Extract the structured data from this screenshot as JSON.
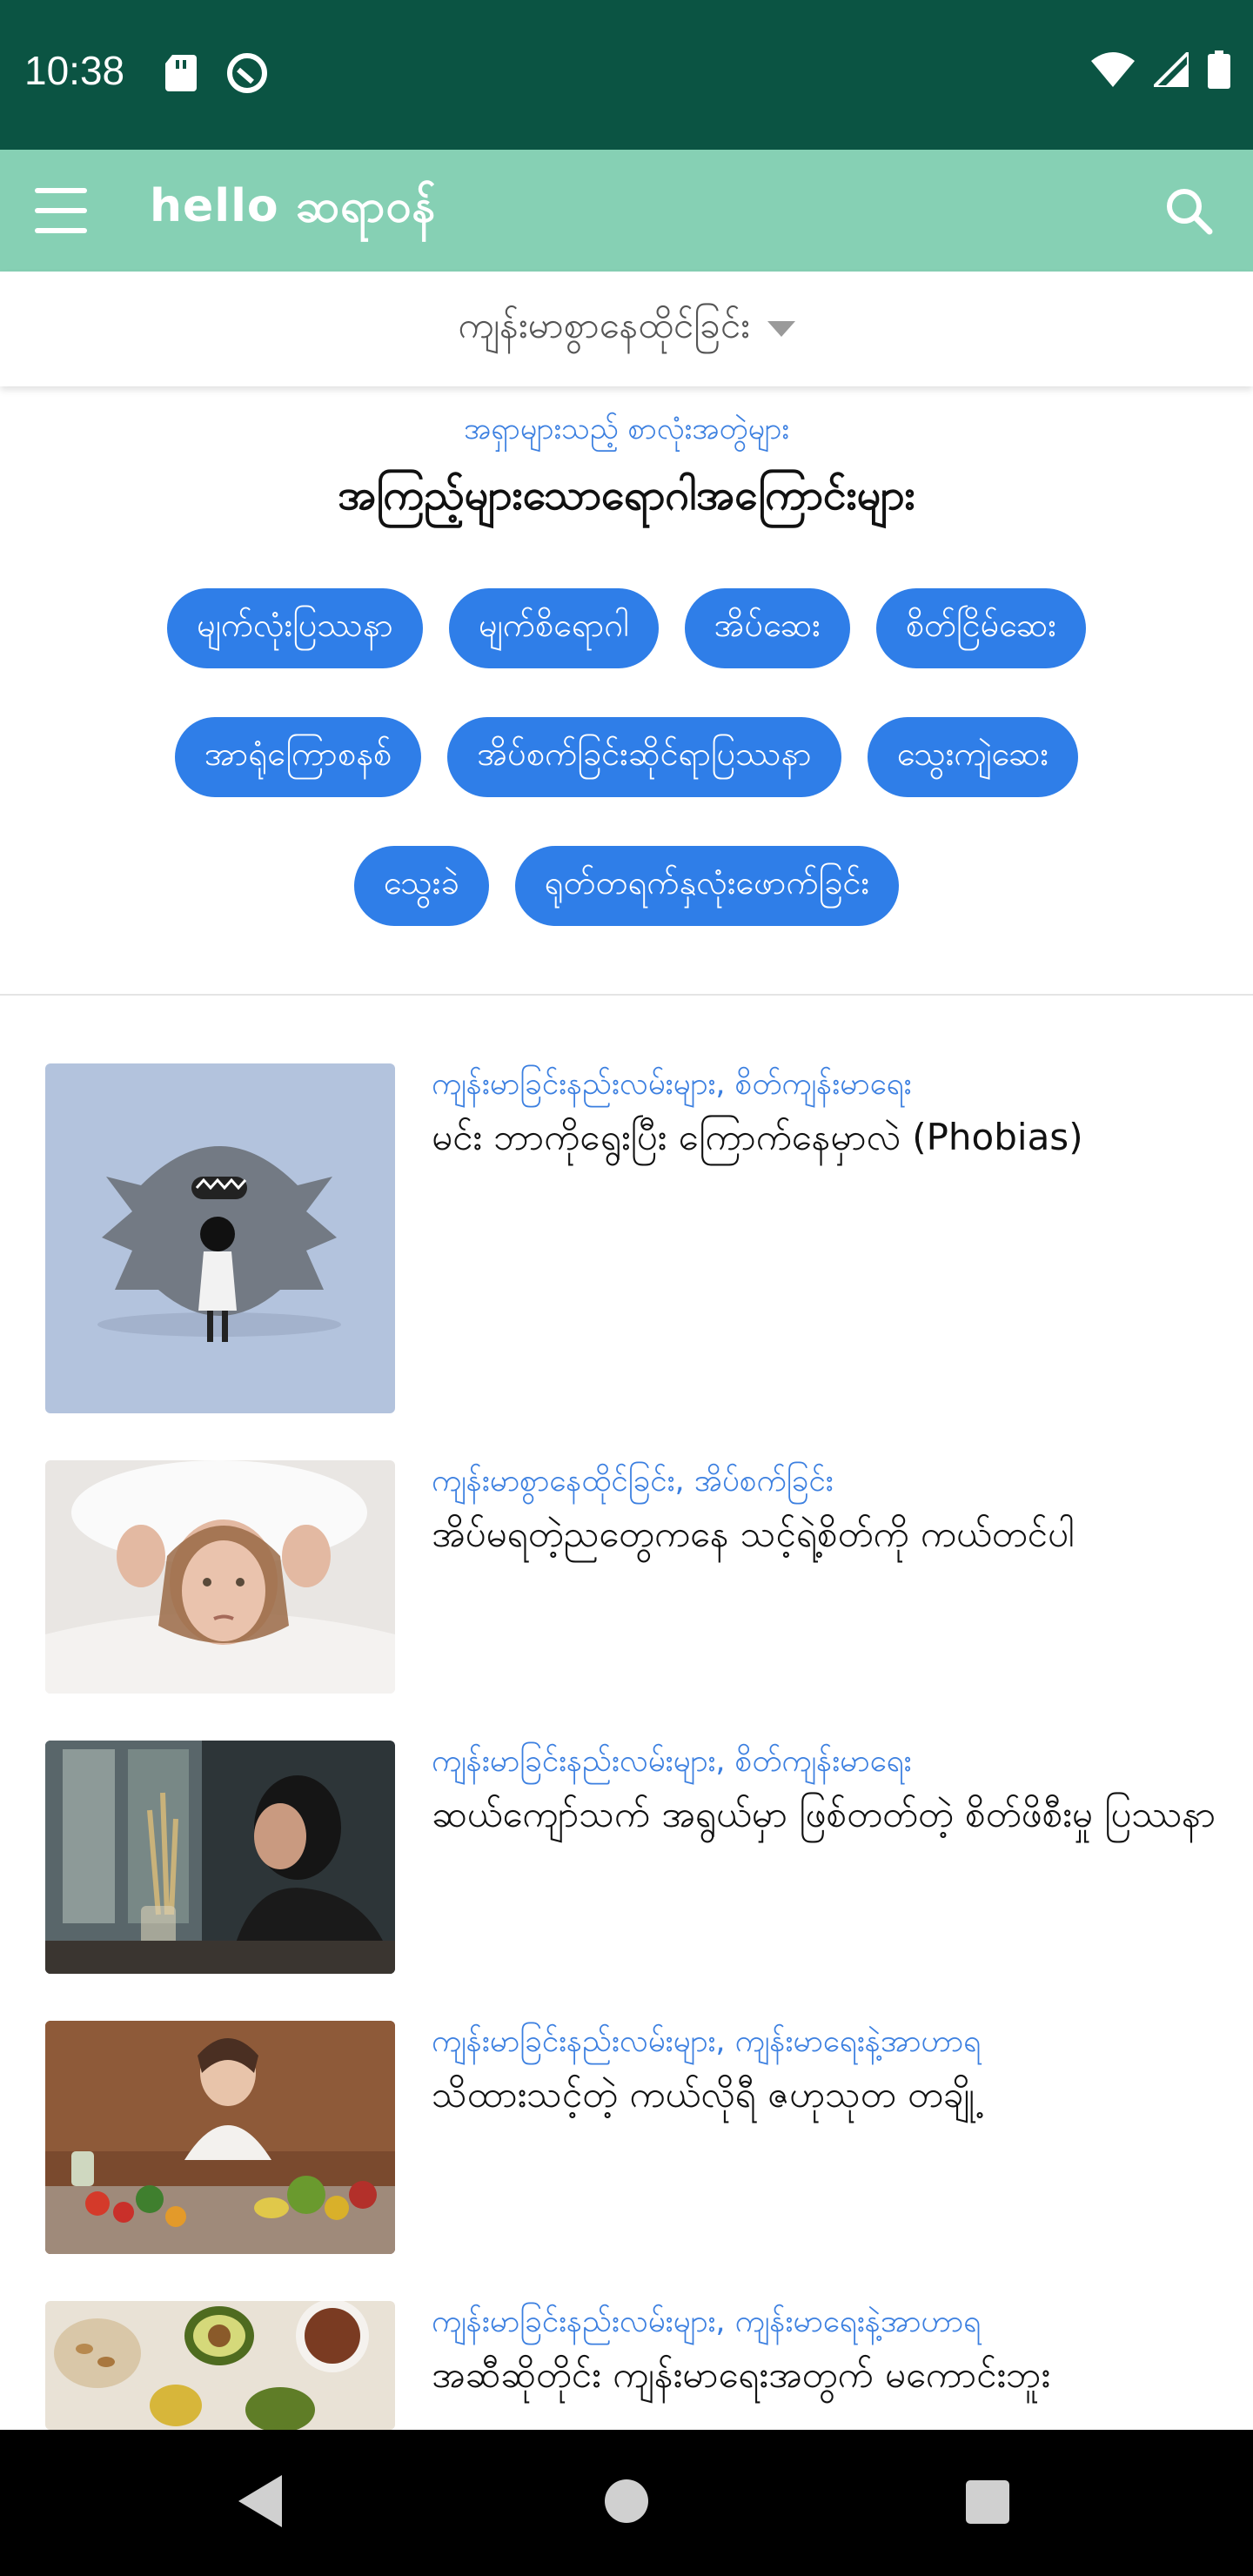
{
  "status_bar": {
    "time": "10:38"
  },
  "app_bar": {
    "brand": "hello ဆရာဝန်"
  },
  "filter": {
    "label": "ကျန်းမာစွာနေထိုင်ခြင်း"
  },
  "section": {
    "eyebrow": "အရှာများသည့် စာလုံးအတွဲများ",
    "title": "အကြည့်များသောရောဂါအကြောင်းများ"
  },
  "chips": [
    "မျက်လုံးပြဿနာ",
    "မျက်စိရောဂါ",
    "အိပ်ဆေး",
    "စိတ်ငြိမ်ဆေး",
    "အာရုံကြောစနစ်",
    "အိပ်စက်ခြင်းဆိုင်ရာပြဿနာ",
    "သွေးကျဲဆေး",
    "သွေးခဲ",
    "ရုတ်တရက်နှလုံးဖောက်ခြင်း"
  ],
  "articles": [
    {
      "category": "ကျန်းမာခြင်းနည်းလမ်းများ, စိတ်ကျန်းမာရေး",
      "title": "မင်း ဘာကိုရွေးပြီး ကြောက်နေမှာလဲ (Phobias)"
    },
    {
      "category": "ကျန်းမာစွာနေထိုင်ခြင်း, အိပ်စက်ခြင်း",
      "title": "အိပ်မရတဲ့ညတွေကနေ သင့်ရဲ့စိတ်ကို ကယ်တင်ပါ"
    },
    {
      "category": "ကျန်းမာခြင်းနည်းလမ်းများ, စိတ်ကျန်းမာရေး",
      "title": "ဆယ်ကျော်သက် အရွယ်မှာ ဖြစ်တတ်တဲ့ စိတ်ဖိစီးမှု ပြဿနာ"
    },
    {
      "category": "ကျန်းမာခြင်းနည်းလမ်းများ, ကျန်းမာရေးနဲ့အာဟာရ",
      "title": "သိထားသင့်တဲ့ ကယ်လိုရီ ဇဟုသုတ တချို့"
    },
    {
      "category": "ကျန်းမာခြင်းနည်းလမ်းများ, ကျန်းမာရေးနဲ့အာဟာရ",
      "title": "အဆီဆိုတိုင်း ကျန်းမာရေးအတွက် မကောင်းဘူး"
    }
  ],
  "colors": {
    "status_bar": "#0b5443",
    "app_bar": "#86d0b4",
    "chip": "#2f7ee8",
    "link": "#3b7fe0"
  }
}
